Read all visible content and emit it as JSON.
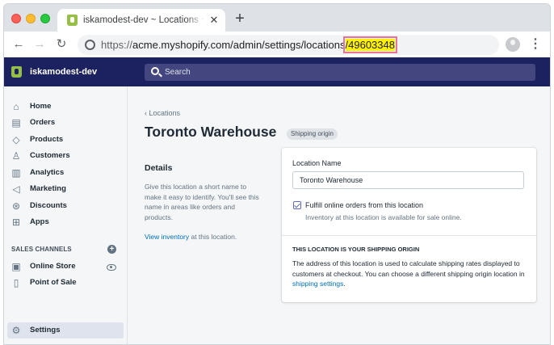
{
  "browser": {
    "tab_title": "iskamodest-dev ~ Locations ~ Toronto Warehouse",
    "tab_close": "✕",
    "new_tab": "+",
    "url_prefix": "https://",
    "url_main": "acme.myshopify.com/admin/settings/locations",
    "url_id": "/49603348",
    "menu": "⋮"
  },
  "topbar": {
    "store_name": "iskamodest-dev",
    "search_placeholder": "Search"
  },
  "sidebar": {
    "items": [
      {
        "label": "Home",
        "icon": "home-icon",
        "glyph": "⌂"
      },
      {
        "label": "Orders",
        "icon": "orders-icon",
        "glyph": "▤"
      },
      {
        "label": "Products",
        "icon": "tag-icon",
        "glyph": "◇"
      },
      {
        "label": "Customers",
        "icon": "person-icon",
        "glyph": "♙"
      },
      {
        "label": "Analytics",
        "icon": "analytics-icon",
        "glyph": "▥"
      },
      {
        "label": "Marketing",
        "icon": "megaphone-icon",
        "glyph": "◁"
      },
      {
        "label": "Discounts",
        "icon": "discount-icon",
        "glyph": "⊛"
      },
      {
        "label": "Apps",
        "icon": "apps-icon",
        "glyph": "⊞"
      }
    ],
    "sales_channels_header": "SALES CHANNELS",
    "channels": [
      {
        "label": "Online Store",
        "icon": "store-icon",
        "glyph": "▣"
      },
      {
        "label": "Point of Sale",
        "icon": "pos-icon",
        "glyph": "▯"
      }
    ],
    "settings_label": "Settings",
    "settings_glyph": "⚙"
  },
  "main": {
    "breadcrumb": "‹ Locations",
    "title": "Toronto Warehouse",
    "badge": "Shipping origin",
    "details_heading": "Details",
    "details_description": "Give this location a short name to make it easy to identify. You'll see this name in areas like orders and products.",
    "view_inventory_link": "View inventory",
    "view_inventory_suffix": " at this location.",
    "card": {
      "location_name_label": "Location Name",
      "location_name_value": "Toronto Warehouse",
      "fulfill_checked": true,
      "fulfill_label": "Fulfill online orders from this location",
      "fulfill_help": "Inventory at this location is available for sale online.",
      "origin_heading": "THIS LOCATION IS YOUR SHIPPING ORIGIN",
      "origin_description": "The address of this location is used to calculate shipping rates displayed to customers at checkout. You can choose a different shipping origin location in ",
      "origin_link": "shipping settings",
      "origin_suffix": "."
    }
  },
  "colors": {
    "topbar": "#1c2260",
    "accent": "#5c6ac4",
    "link": "#006fbb",
    "url_highlight": "#fff200"
  }
}
